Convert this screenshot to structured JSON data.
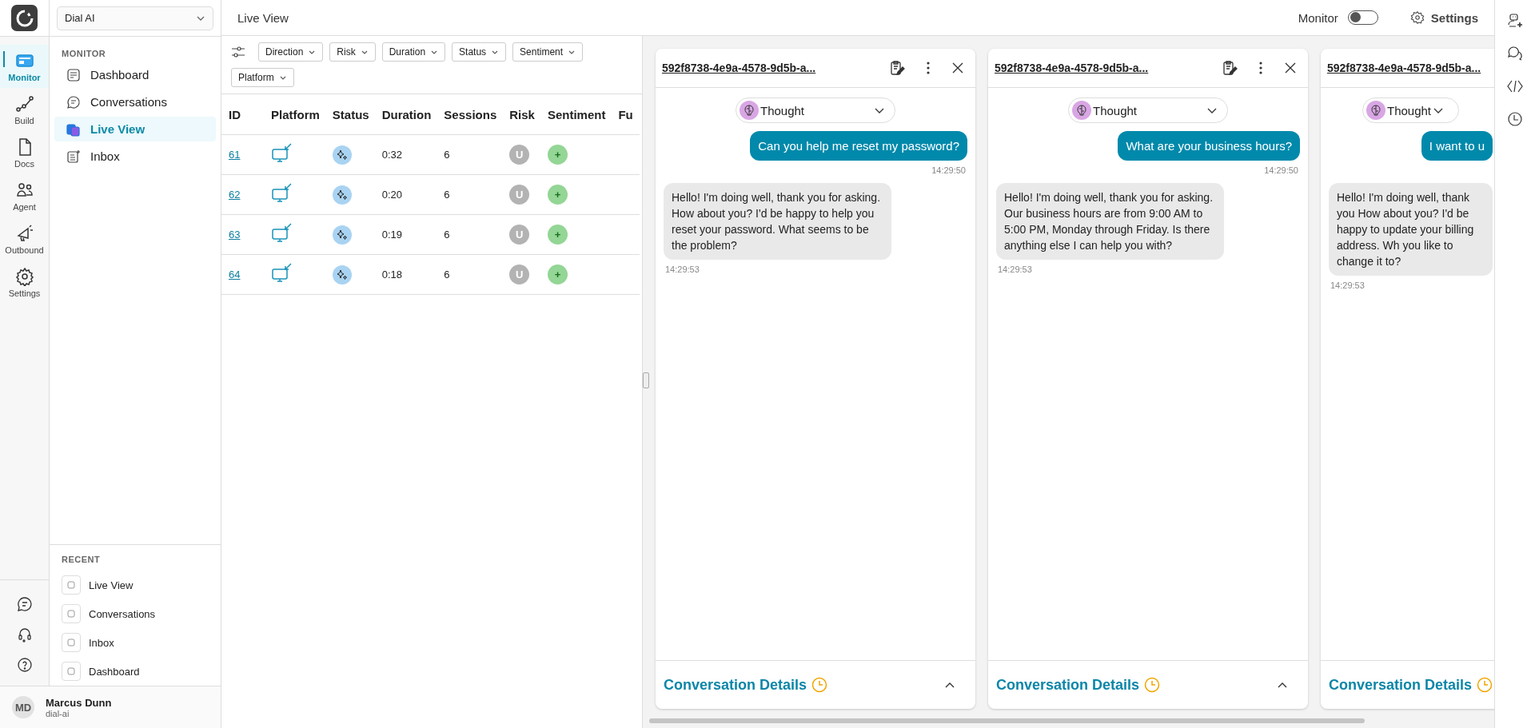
{
  "workspace": {
    "name": "Dial AI"
  },
  "nav_rail": {
    "items": [
      {
        "label": "Monitor",
        "selected": true
      },
      {
        "label": "Build",
        "selected": false
      },
      {
        "label": "Docs",
        "selected": false
      },
      {
        "label": "Agent",
        "selected": false
      },
      {
        "label": "Outbound",
        "selected": false
      },
      {
        "label": "Settings",
        "selected": false
      }
    ]
  },
  "sidebar": {
    "section": "MONITOR",
    "items": [
      {
        "label": "Dashboard",
        "selected": false
      },
      {
        "label": "Conversations",
        "selected": false
      },
      {
        "label": "Live View",
        "selected": true
      },
      {
        "label": "Inbox",
        "selected": false
      }
    ],
    "recent_title": "RECENT",
    "recent": [
      "Live View",
      "Conversations",
      "Inbox",
      "Dashboard"
    ]
  },
  "user": {
    "initials": "MD",
    "name": "Marcus Dunn",
    "org": "dial-ai"
  },
  "header": {
    "title": "Live View",
    "monitor_label": "Monitor",
    "monitor_on": false,
    "settings": "Settings"
  },
  "filters": [
    "Direction",
    "Risk",
    "Duration",
    "Status",
    "Sentiment",
    "Platform"
  ],
  "table": {
    "columns": [
      "ID",
      "Platform",
      "Status",
      "Duration",
      "Sessions",
      "Risk",
      "Sentiment",
      "Fu"
    ],
    "rows": [
      {
        "id": "61",
        "duration": "0:32",
        "sessions": "6",
        "risk": "U",
        "sentiment": "+"
      },
      {
        "id": "62",
        "duration": "0:20",
        "sessions": "6",
        "risk": "U",
        "sentiment": "+"
      },
      {
        "id": "63",
        "duration": "0:19",
        "sessions": "6",
        "risk": "U",
        "sentiment": "+"
      },
      {
        "id": "64",
        "duration": "0:18",
        "sessions": "6",
        "risk": "U",
        "sentiment": "+"
      }
    ]
  },
  "panels": [
    {
      "title": "592f8738-4e9a-4578-9d5b-a...",
      "tools": true,
      "thought": "Thought",
      "user_message": "Can you help me reset my password?",
      "user_time": "14:29:50",
      "agent_message": "Hello! I'm doing well, thank you for asking. How about you? I'd be happy to help you reset your password. What seems to be the problem?",
      "agent_time": "14:29:53",
      "details": "Conversation Details"
    },
    {
      "title": "592f8738-4e9a-4578-9d5b-a...",
      "tools": true,
      "thought": "Thought",
      "user_message": "What are your business hours?",
      "user_time": "14:29:50",
      "agent_message": "Hello! I'm doing well, thank you for asking. Our business hours are from 9:00 AM to 5:00 PM, Monday through Friday. Is there anything else I can help you with?",
      "agent_time": "14:29:53",
      "details": "Conversation Details"
    },
    {
      "title": "592f8738-4e9a-4578-9d5b-a...",
      "tools": false,
      "thought": "Thought",
      "user_message": "I want to u",
      "agent_message": "Hello! I'm doing well, thank you How about you? I'd be happy to update your billing address. Wh you like to change it to?",
      "agent_time": "14:29:53",
      "details": "Conversation Details"
    }
  ]
}
